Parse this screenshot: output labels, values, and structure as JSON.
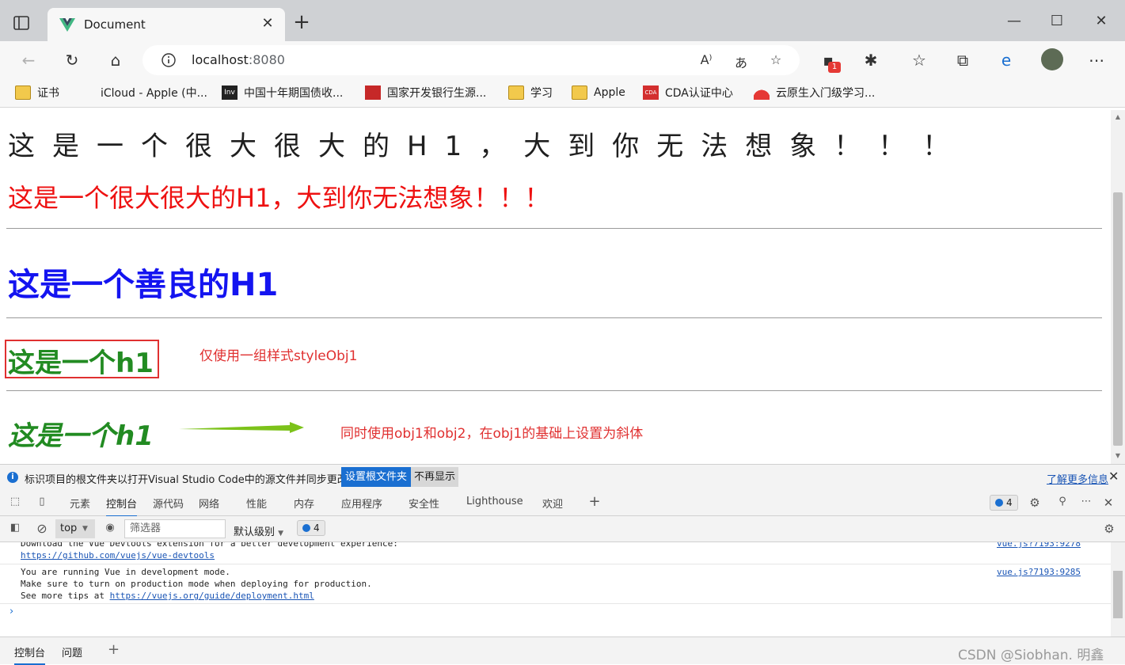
{
  "browser": {
    "tab_title": "Document",
    "url_host": "localhost",
    "url_port": ":8080",
    "extension_badge": "1",
    "bookmarks": [
      {
        "label": "证书",
        "icon": "folder-icon"
      },
      {
        "label": "iCloud - Apple (中...",
        "icon": "apple-icon"
      },
      {
        "label": "中国十年期国债收...",
        "icon": "investing-icon"
      },
      {
        "label": "国家开发银行生源...",
        "icon": "cdb-icon"
      },
      {
        "label": "学习",
        "icon": "folder-icon"
      },
      {
        "label": "Apple",
        "icon": "folder-icon"
      },
      {
        "label": "CDA认证中心",
        "icon": "cda-icon"
      },
      {
        "label": "云原生入门级学习...",
        "icon": "huawei-icon"
      }
    ]
  },
  "page": {
    "h1_spaced": "这是一个很大很大的H1，大到你无法想象！！！",
    "h1_red": "这是一个很大很大的H1，大到你无法想象！！！",
    "h1_blue": "这是一个善良的H1",
    "h1_green": "这是一个h1",
    "note1": "仅使用一组样式styleObj1",
    "h1_green_italic": "这是一个h1",
    "note2": "同时使用obj1和obj2，在obj1的基础上设置为斜体"
  },
  "infobar": {
    "message": "标识项目的根文件夹以打开Visual Studio Code中的源文件并同步更改。",
    "primary_button": "设置根文件夹",
    "secondary_button": "不再显示",
    "learn_more": "了解更多信息"
  },
  "devtools": {
    "tabs": [
      "元素",
      "控制台",
      "源代码",
      "网络",
      "性能",
      "内存",
      "应用程序",
      "安全性",
      "Lighthouse",
      "欢迎"
    ],
    "active_tab": "控制台",
    "issues_count": "4",
    "context": "top",
    "filter_placeholder": "筛选器",
    "levels": "默认级别",
    "messages_count": "4",
    "logs": [
      {
        "lines": [
          "Download the Vue Devtools extension for a better development experience:"
        ],
        "link": "https://github.com/vuejs/vue-devtools",
        "source": "vue.js?7193:9278"
      },
      {
        "lines": [
          "You are running Vue in development mode.",
          "Make sure to turn on production mode when deploying for production."
        ],
        "tip_prefix": "See more tips at ",
        "link": "https://vuejs.org/guide/deployment.html",
        "source": "vue.js?7193:9285"
      }
    ],
    "drawer_tabs": [
      "控制台",
      "问题"
    ]
  },
  "watermark": "CSDN @Siobhan. 明鑫",
  "colors": {
    "red": "#ee1111",
    "blue": "#1414f0",
    "green": "#228b22",
    "accent": "#1a6fd1"
  }
}
